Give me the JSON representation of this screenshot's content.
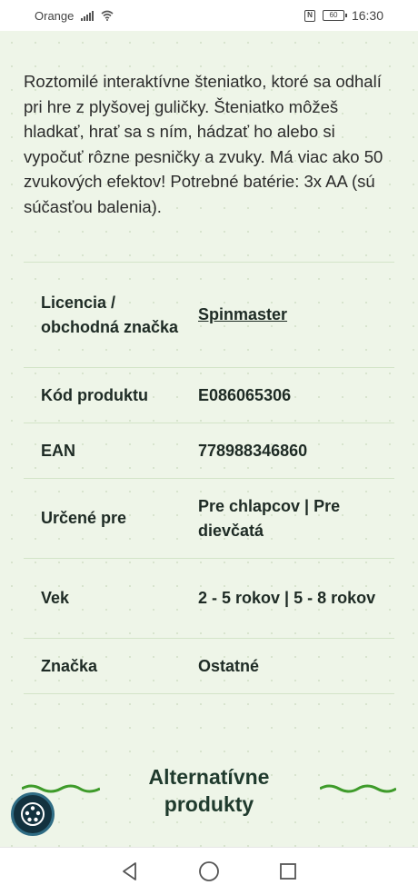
{
  "status": {
    "carrier": "Orange",
    "time": "16:30",
    "battery": "60",
    "nfc": "N"
  },
  "description": "Roztomilé interaktívne šteniatko, ktoré sa odhalí pri hre z plyšovej guličky. Šteniatko môžeš hladkať, hrať sa s ním, hádzať ho alebo si vypočuť rôzne pesničky a zvuky. Má viac ako 50 zvukových efektov! Potrebné batérie: 3x AA (sú súčasťou balenia).",
  "specs": [
    {
      "label": "Licencia / obchodná značka",
      "value": "Spinmaster",
      "link": true
    },
    {
      "label": "Kód produktu",
      "value": "E086065306"
    },
    {
      "label": "EAN",
      "value": "778988346860"
    },
    {
      "label": "Určené pre",
      "value": "Pre chlapcov | Pre dievčatá"
    },
    {
      "label": "Vek",
      "value": "2 - 5 rokov | 5 - 8 rokov"
    },
    {
      "label": "Značka",
      "value": "Ostatné"
    }
  ],
  "alternatives_heading": "Alternatívne produkty",
  "colors": {
    "background": "#eef5e8",
    "accent_green": "#3e9b2a",
    "heading": "#1f3a2d",
    "fab": "#13323f"
  },
  "icons": {
    "fab": "accessibility-icon",
    "nav_back": "back-triangle-icon",
    "nav_home": "home-circle-icon",
    "nav_recent": "recent-square-icon"
  }
}
